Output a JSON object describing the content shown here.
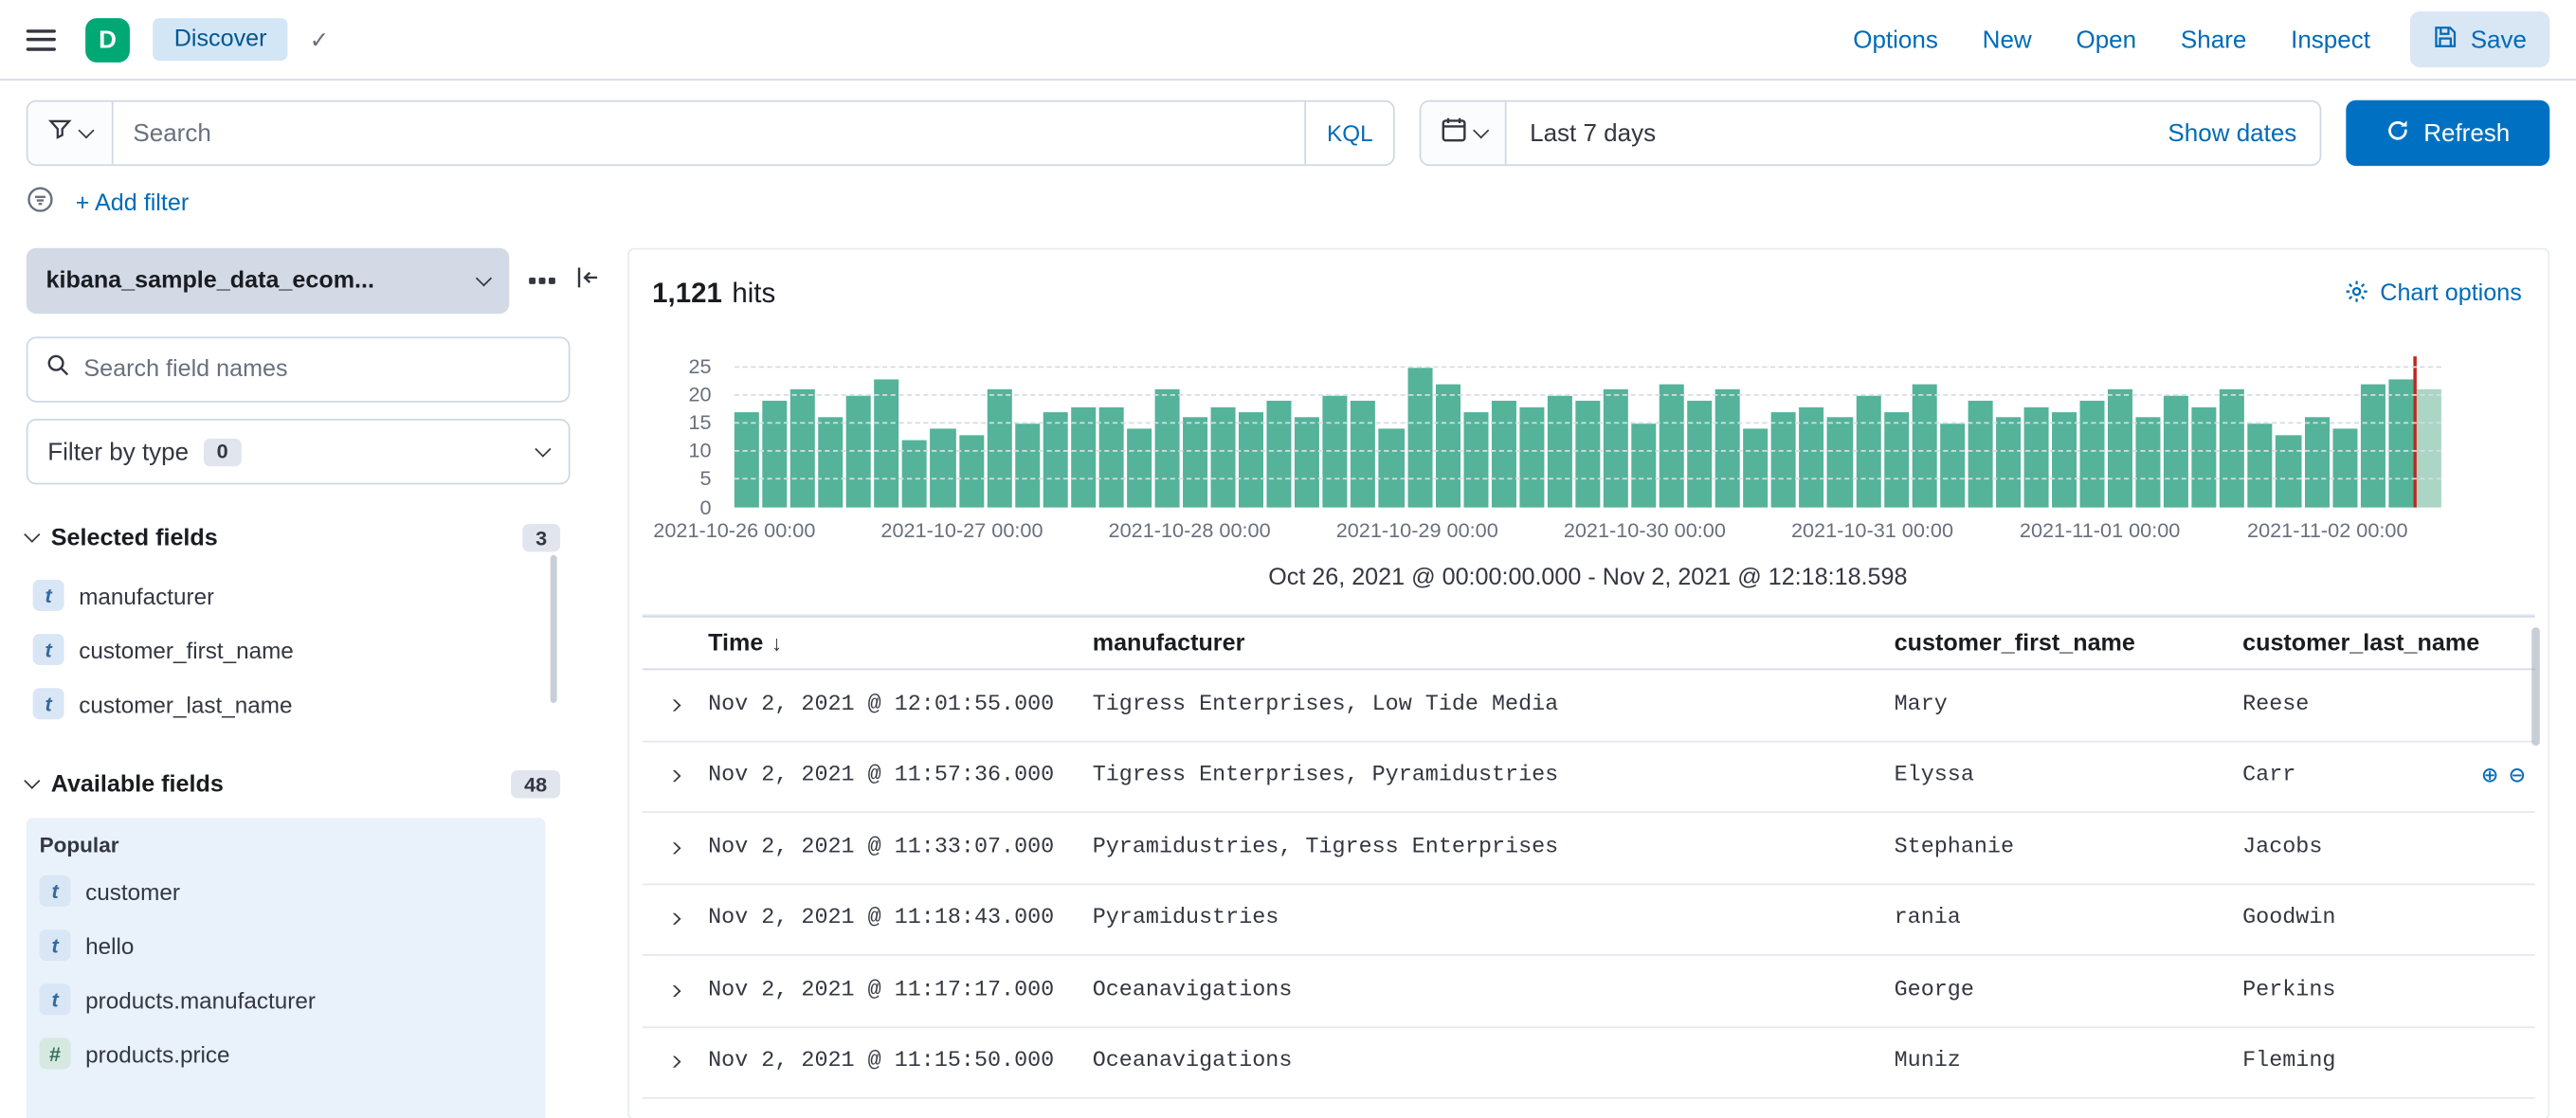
{
  "colors": {
    "link_blue": "#006bb8",
    "refresh_button": "#0071c2",
    "bar_green": "#54b399",
    "time_marker_red": "#bd271e",
    "space_badge_green": "#00a874",
    "border": "#d3dae6"
  },
  "icons": {
    "check": "✓",
    "sort_desc": "↓",
    "filter_for": "⊕",
    "filter_out": "⊖"
  },
  "header": {
    "space_badge": "D",
    "breadcrumb": "Discover",
    "nav_links": [
      "Options",
      "New",
      "Open",
      "Share",
      "Inspect"
    ],
    "save_label": "Save"
  },
  "query_bar": {
    "search_placeholder": "Search",
    "language_label": "KQL",
    "time_range": "Last 7 days",
    "show_dates_label": "Show dates",
    "refresh_label": "Refresh"
  },
  "filter_bar": {
    "add_filter_label": "+ Add filter"
  },
  "sidebar": {
    "index_pattern": "kibana_sample_data_ecom...",
    "field_search_placeholder": "Search field names",
    "filter_by_type_label": "Filter by type",
    "filter_by_type_count": "0",
    "selected": {
      "label": "Selected fields",
      "count": "3",
      "fields": [
        {
          "type": "t",
          "name": "manufacturer"
        },
        {
          "type": "t",
          "name": "customer_first_name"
        },
        {
          "type": "t",
          "name": "customer_last_name"
        }
      ]
    },
    "available": {
      "label": "Available fields",
      "count": "48",
      "popular_label": "Popular",
      "popular_fields": [
        {
          "type": "t",
          "name": "customer"
        },
        {
          "type": "t",
          "name": "hello"
        },
        {
          "type": "t",
          "name": "products.manufacturer"
        },
        {
          "type": "#",
          "name": "products.price"
        }
      ]
    }
  },
  "main": {
    "hits_value": "1,121",
    "hits_label": "hits",
    "chart_options_label": "Chart options",
    "time_range_caption": "Oct 26, 2021 @ 00:00:00.000 - Nov 2, 2021 @ 12:18:18.598"
  },
  "chart_data": {
    "type": "bar",
    "title": "",
    "values": [
      17,
      19,
      21,
      16,
      20,
      23,
      12,
      14,
      13,
      21,
      15,
      17,
      18,
      18,
      14,
      21,
      16,
      18,
      17,
      19,
      16,
      20,
      19,
      14,
      25,
      22,
      17,
      19,
      18,
      20,
      19,
      21,
      15,
      22,
      19,
      21,
      14,
      17,
      18,
      16,
      20,
      17,
      22,
      15,
      19,
      16,
      18,
      17,
      19,
      21,
      16,
      20,
      18,
      21,
      15,
      13,
      16,
      14,
      22,
      23,
      21
    ],
    "ylim": [
      0,
      27
    ],
    "y_ticks": [
      0,
      5,
      10,
      15,
      20,
      25
    ],
    "x_tick_labels": [
      "2021-10-26 00:00",
      "2021-10-27 00:00",
      "2021-10-28 00:00",
      "2021-10-29 00:00",
      "2021-10-30 00:00",
      "2021-10-31 00:00",
      "2021-11-01 00:00",
      "2021-11-02 00:00"
    ],
    "x_axis_span_days": 7.5,
    "grid": true,
    "legend": false,
    "partial_last_bar": true,
    "current_time_marker": true
  },
  "table": {
    "columns": [
      "Time",
      "manufacturer",
      "customer_first_name",
      "customer_last_name"
    ],
    "sorted_column": "Time",
    "sort_direction": "desc",
    "rows": [
      {
        "time": "Nov 2, 2021 @ 12:01:55.000",
        "manufacturer": "Tigress Enterprises, Low Tide Media",
        "customer_first_name": "Mary",
        "customer_last_name": "Reese",
        "show_actions": false
      },
      {
        "time": "Nov 2, 2021 @ 11:57:36.000",
        "manufacturer": "Tigress Enterprises, Pyramidustries",
        "customer_first_name": "Elyssa",
        "customer_last_name": "Carr",
        "show_actions": true
      },
      {
        "time": "Nov 2, 2021 @ 11:33:07.000",
        "manufacturer": "Pyramidustries, Tigress Enterprises",
        "customer_first_name": "Stephanie",
        "customer_last_name": "Jacobs",
        "show_actions": false
      },
      {
        "time": "Nov 2, 2021 @ 11:18:43.000",
        "manufacturer": "Pyramidustries",
        "customer_first_name": "rania",
        "customer_last_name": "Goodwin",
        "show_actions": false
      },
      {
        "time": "Nov 2, 2021 @ 11:17:17.000",
        "manufacturer": "Oceanavigations",
        "customer_first_name": "George",
        "customer_last_name": "Perkins",
        "show_actions": false
      },
      {
        "time": "Nov 2, 2021 @ 11:15:50.000",
        "manufacturer": "Oceanavigations",
        "customer_first_name": "Muniz",
        "customer_last_name": "Fleming",
        "show_actions": false
      }
    ]
  }
}
